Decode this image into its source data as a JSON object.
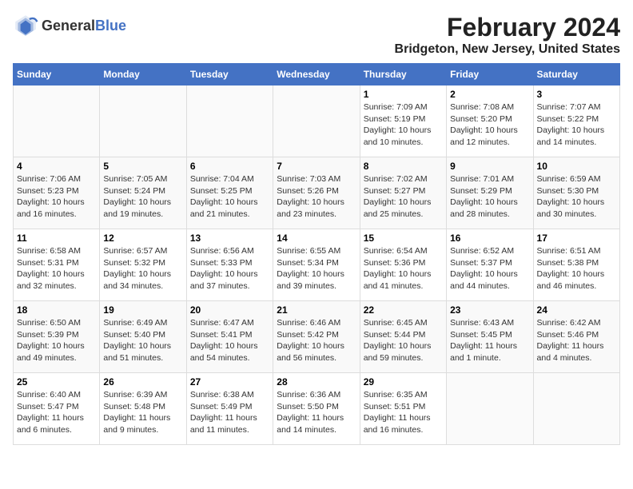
{
  "header": {
    "logo_general": "General",
    "logo_blue": "Blue",
    "title": "February 2024",
    "subtitle": "Bridgeton, New Jersey, United States"
  },
  "days_of_week": [
    "Sunday",
    "Monday",
    "Tuesday",
    "Wednesday",
    "Thursday",
    "Friday",
    "Saturday"
  ],
  "weeks": [
    [
      {
        "num": "",
        "info": ""
      },
      {
        "num": "",
        "info": ""
      },
      {
        "num": "",
        "info": ""
      },
      {
        "num": "",
        "info": ""
      },
      {
        "num": "1",
        "info": "Sunrise: 7:09 AM\nSunset: 5:19 PM\nDaylight: 10 hours\nand 10 minutes."
      },
      {
        "num": "2",
        "info": "Sunrise: 7:08 AM\nSunset: 5:20 PM\nDaylight: 10 hours\nand 12 minutes."
      },
      {
        "num": "3",
        "info": "Sunrise: 7:07 AM\nSunset: 5:22 PM\nDaylight: 10 hours\nand 14 minutes."
      }
    ],
    [
      {
        "num": "4",
        "info": "Sunrise: 7:06 AM\nSunset: 5:23 PM\nDaylight: 10 hours\nand 16 minutes."
      },
      {
        "num": "5",
        "info": "Sunrise: 7:05 AM\nSunset: 5:24 PM\nDaylight: 10 hours\nand 19 minutes."
      },
      {
        "num": "6",
        "info": "Sunrise: 7:04 AM\nSunset: 5:25 PM\nDaylight: 10 hours\nand 21 minutes."
      },
      {
        "num": "7",
        "info": "Sunrise: 7:03 AM\nSunset: 5:26 PM\nDaylight: 10 hours\nand 23 minutes."
      },
      {
        "num": "8",
        "info": "Sunrise: 7:02 AM\nSunset: 5:27 PM\nDaylight: 10 hours\nand 25 minutes."
      },
      {
        "num": "9",
        "info": "Sunrise: 7:01 AM\nSunset: 5:29 PM\nDaylight: 10 hours\nand 28 minutes."
      },
      {
        "num": "10",
        "info": "Sunrise: 6:59 AM\nSunset: 5:30 PM\nDaylight: 10 hours\nand 30 minutes."
      }
    ],
    [
      {
        "num": "11",
        "info": "Sunrise: 6:58 AM\nSunset: 5:31 PM\nDaylight: 10 hours\nand 32 minutes."
      },
      {
        "num": "12",
        "info": "Sunrise: 6:57 AM\nSunset: 5:32 PM\nDaylight: 10 hours\nand 34 minutes."
      },
      {
        "num": "13",
        "info": "Sunrise: 6:56 AM\nSunset: 5:33 PM\nDaylight: 10 hours\nand 37 minutes."
      },
      {
        "num": "14",
        "info": "Sunrise: 6:55 AM\nSunset: 5:34 PM\nDaylight: 10 hours\nand 39 minutes."
      },
      {
        "num": "15",
        "info": "Sunrise: 6:54 AM\nSunset: 5:36 PM\nDaylight: 10 hours\nand 41 minutes."
      },
      {
        "num": "16",
        "info": "Sunrise: 6:52 AM\nSunset: 5:37 PM\nDaylight: 10 hours\nand 44 minutes."
      },
      {
        "num": "17",
        "info": "Sunrise: 6:51 AM\nSunset: 5:38 PM\nDaylight: 10 hours\nand 46 minutes."
      }
    ],
    [
      {
        "num": "18",
        "info": "Sunrise: 6:50 AM\nSunset: 5:39 PM\nDaylight: 10 hours\nand 49 minutes."
      },
      {
        "num": "19",
        "info": "Sunrise: 6:49 AM\nSunset: 5:40 PM\nDaylight: 10 hours\nand 51 minutes."
      },
      {
        "num": "20",
        "info": "Sunrise: 6:47 AM\nSunset: 5:41 PM\nDaylight: 10 hours\nand 54 minutes."
      },
      {
        "num": "21",
        "info": "Sunrise: 6:46 AM\nSunset: 5:42 PM\nDaylight: 10 hours\nand 56 minutes."
      },
      {
        "num": "22",
        "info": "Sunrise: 6:45 AM\nSunset: 5:44 PM\nDaylight: 10 hours\nand 59 minutes."
      },
      {
        "num": "23",
        "info": "Sunrise: 6:43 AM\nSunset: 5:45 PM\nDaylight: 11 hours\nand 1 minute."
      },
      {
        "num": "24",
        "info": "Sunrise: 6:42 AM\nSunset: 5:46 PM\nDaylight: 11 hours\nand 4 minutes."
      }
    ],
    [
      {
        "num": "25",
        "info": "Sunrise: 6:40 AM\nSunset: 5:47 PM\nDaylight: 11 hours\nand 6 minutes."
      },
      {
        "num": "26",
        "info": "Sunrise: 6:39 AM\nSunset: 5:48 PM\nDaylight: 11 hours\nand 9 minutes."
      },
      {
        "num": "27",
        "info": "Sunrise: 6:38 AM\nSunset: 5:49 PM\nDaylight: 11 hours\nand 11 minutes."
      },
      {
        "num": "28",
        "info": "Sunrise: 6:36 AM\nSunset: 5:50 PM\nDaylight: 11 hours\nand 14 minutes."
      },
      {
        "num": "29",
        "info": "Sunrise: 6:35 AM\nSunset: 5:51 PM\nDaylight: 11 hours\nand 16 minutes."
      },
      {
        "num": "",
        "info": ""
      },
      {
        "num": "",
        "info": ""
      }
    ]
  ]
}
